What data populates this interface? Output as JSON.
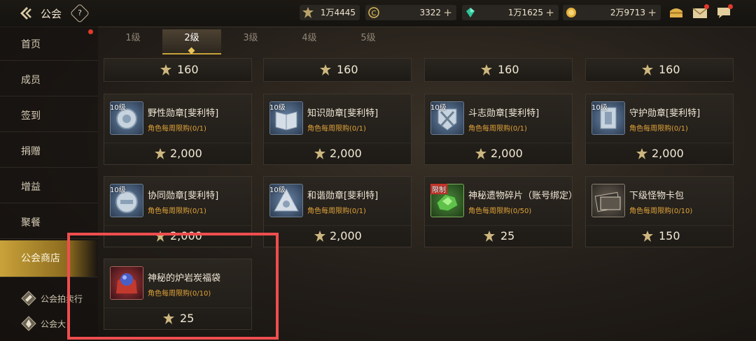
{
  "header": {
    "title": "公会",
    "help_label": "?",
    "currencies": [
      {
        "value": "1万4445",
        "icon": "sunburst-coin-icon"
      },
      {
        "value": "3322",
        "icon": "c-coin-icon"
      },
      {
        "value": "1万1625",
        "icon": "green-gem-icon"
      },
      {
        "value": "2万9713",
        "icon": "gold-coin-icon"
      }
    ],
    "plus_label": "+"
  },
  "sidebar": {
    "items": [
      {
        "label": "首页"
      },
      {
        "label": "成员"
      },
      {
        "label": "签到"
      },
      {
        "label": "捐赠"
      },
      {
        "label": "增益"
      },
      {
        "label": "聚餐"
      },
      {
        "label": "公会商店"
      }
    ],
    "sub_items": [
      {
        "label": "公会拍卖行"
      },
      {
        "label": "公会大"
      }
    ]
  },
  "tabs": [
    {
      "label": "1级"
    },
    {
      "label": "2级"
    },
    {
      "label": "3级"
    },
    {
      "label": "4级"
    },
    {
      "label": "5级"
    }
  ],
  "active_tab": "2级",
  "top_prices": [
    "160",
    "160",
    "160",
    "160"
  ],
  "items": [
    {
      "badge": "10级",
      "name": "野性勋章[斐利特]",
      "limit": "角色每周限购(0/1)",
      "price": "2,000"
    },
    {
      "badge": "10级",
      "name": "知识勋章[斐利特]",
      "limit": "角色每周限购(0/1)",
      "price": "2,000"
    },
    {
      "badge": "10级",
      "name": "斗志勋章[斐利特]",
      "limit": "角色每周限购(0/1)",
      "price": "2,000"
    },
    {
      "badge": "10级",
      "name": "守护勋章[斐利特]",
      "limit": "角色每周限购(0/1)",
      "price": "2,000"
    },
    {
      "badge": "10级",
      "name": "协同勋章[斐利特]",
      "limit": "角色每周限购(0/1)",
      "price": "2,000"
    },
    {
      "badge": "10级",
      "name": "和谐勋章[斐利特]",
      "limit": "角色每周限购(0/1)",
      "price": "2,000"
    },
    {
      "badge": "限制",
      "name": "神秘遗物碎片（账号绑定）",
      "limit": "角色每周限购(0/50)",
      "price": "25"
    },
    {
      "badge": "",
      "name": "下级怪物卡包",
      "limit": "角色每周限购(0/10)",
      "price": "150"
    },
    {
      "badge": "",
      "name": "神秘的炉岩炭福袋",
      "limit": "角色每周限购(0/10)",
      "price": "25"
    }
  ],
  "colors": {
    "accent": "#c9a23a",
    "limit_text": "#e0a43a",
    "highlight": "#ee4e4e"
  }
}
